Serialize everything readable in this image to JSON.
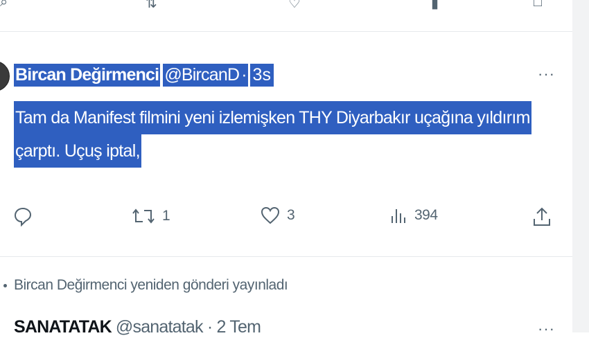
{
  "tweet": {
    "author_name": "Bircan Değirmenci",
    "handle": "@BircanD",
    "separator": "·",
    "time": "3s",
    "text_line1": "Tam da Manifest filmini yeni izlemişken THY Diyarbakır uçağına yıldırım",
    "text_line2": "çarptı. Uçuş iptal,",
    "more_label": "···",
    "actions": {
      "reply_icon": "reply-icon",
      "repost_icon": "repost-icon",
      "repost_count": "1",
      "like_icon": "heart-icon",
      "like_count": "3",
      "views_icon": "views-icon",
      "views_count": "394",
      "share_icon": "share-icon"
    }
  },
  "repost_notice": {
    "text": "Bircan Değirmenci yeniden gönderi yayınladı"
  },
  "next_tweet": {
    "author_name": "SANATATAK",
    "meta": "@sanatatak · 2 Tem",
    "more_label": "···"
  },
  "colors": {
    "selection": "#2f5fc0",
    "muted": "#536471",
    "divider": "#e6e9ec"
  }
}
